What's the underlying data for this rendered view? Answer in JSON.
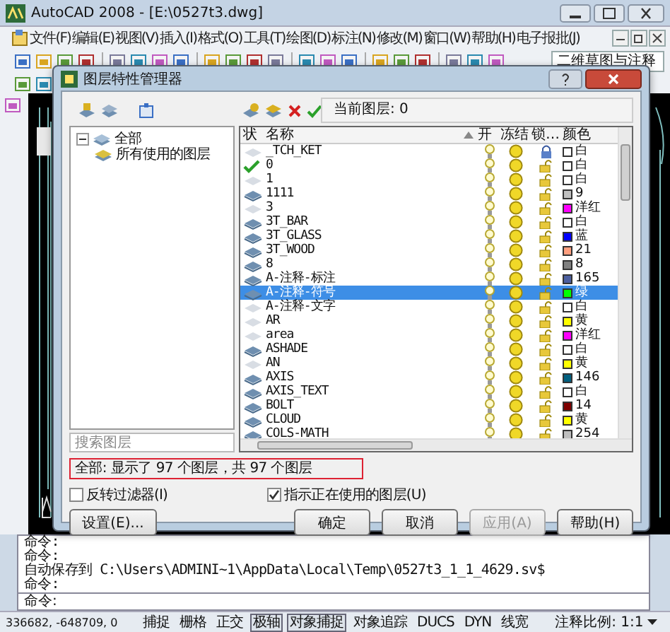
{
  "window": {
    "title": "AutoCAD 2008 - [E:\\0527t3.dwg]"
  },
  "menu": [
    "文件(F)",
    "编辑(E)",
    "视图(V)",
    "插入(I)",
    "格式(O)",
    "工具(T)",
    "绘图(D)",
    "标注(N)",
    "修改(M)",
    "窗口(W)",
    "帮助(H)",
    "电子报批(J)"
  ],
  "workspace": "二维草图与注释",
  "dialog": {
    "title": "图层特性管理器",
    "current_layer": "当前图层: 0",
    "filter_tree": [
      {
        "label": "全部",
        "expanded": true,
        "children": [
          {
            "label": "所有使用的图层"
          }
        ]
      }
    ],
    "search": {
      "placeholder": "搜索图层"
    },
    "columns": [
      "状",
      "名称",
      "开",
      "冻结",
      "锁…",
      "颜色"
    ],
    "layers": [
      {
        "kind": "unused",
        "name": "_TCH_KET",
        "on": true,
        "frozen": false,
        "locked": true,
        "color": "#ffffff",
        "color_name": "白",
        "selected": false
      },
      {
        "kind": "current",
        "name": "0",
        "on": true,
        "frozen": false,
        "locked": false,
        "color": "#ffffff",
        "color_name": "白",
        "selected": false
      },
      {
        "kind": "unused",
        "name": "1",
        "on": true,
        "frozen": false,
        "locked": false,
        "color": "#ffffff",
        "color_name": "白",
        "selected": false
      },
      {
        "kind": "used",
        "name": "1111",
        "on": true,
        "frozen": false,
        "locked": false,
        "color": "#c0c0c0",
        "color_name": "9",
        "selected": false
      },
      {
        "kind": "unused",
        "name": "3",
        "on": true,
        "frozen": false,
        "locked": false,
        "color": "#ff00ff",
        "color_name": "洋红",
        "selected": false
      },
      {
        "kind": "used",
        "name": "3T_BAR",
        "on": true,
        "frozen": false,
        "locked": false,
        "color": "#ffffff",
        "color_name": "白",
        "selected": false
      },
      {
        "kind": "used",
        "name": "3T_GLASS",
        "on": true,
        "frozen": false,
        "locked": false,
        "color": "#0000ff",
        "color_name": "蓝",
        "selected": false
      },
      {
        "kind": "used",
        "name": "3T_WOOD",
        "on": true,
        "frozen": false,
        "locked": false,
        "color": "#ff9f7f",
        "color_name": "21",
        "selected": false
      },
      {
        "kind": "used",
        "name": "8",
        "on": true,
        "frozen": false,
        "locked": false,
        "color": "#808080",
        "color_name": "8",
        "selected": false
      },
      {
        "kind": "used",
        "name": "A-注释-标注",
        "on": true,
        "frozen": false,
        "locked": false,
        "color": "#4c5fa0",
        "color_name": "165",
        "selected": false
      },
      {
        "kind": "used",
        "name": "A-注释-符号",
        "on": true,
        "frozen": false,
        "locked": false,
        "color": "#00ff00",
        "color_name": "绿",
        "selected": true
      },
      {
        "kind": "unused",
        "name": "A-注释-文字",
        "on": true,
        "frozen": false,
        "locked": false,
        "color": "#ffffff",
        "color_name": "白",
        "selected": false
      },
      {
        "kind": "unused",
        "name": "AR",
        "on": true,
        "frozen": false,
        "locked": false,
        "color": "#ffff00",
        "color_name": "黄",
        "selected": false
      },
      {
        "kind": "unused",
        "name": "area",
        "on": true,
        "frozen": false,
        "locked": false,
        "color": "#ff00ff",
        "color_name": "洋红",
        "selected": false
      },
      {
        "kind": "used",
        "name": "ASHADE",
        "on": true,
        "frozen": false,
        "locked": false,
        "color": "#ffffff",
        "color_name": "白",
        "selected": false
      },
      {
        "kind": "unused",
        "name": "AN",
        "on": true,
        "frozen": false,
        "locked": false,
        "color": "#ffff00",
        "color_name": "黄",
        "selected": false
      },
      {
        "kind": "used",
        "name": "AXIS",
        "on": true,
        "frozen": false,
        "locked": false,
        "color": "#005f7f",
        "color_name": "146",
        "selected": false
      },
      {
        "kind": "used",
        "name": "AXIS_TEXT",
        "on": true,
        "frozen": false,
        "locked": false,
        "color": "#ffffff",
        "color_name": "白",
        "selected": false
      },
      {
        "kind": "used",
        "name": "BOLT",
        "on": true,
        "frozen": false,
        "locked": false,
        "color": "#7f0000",
        "color_name": "14",
        "selected": false
      },
      {
        "kind": "used",
        "name": "CLOUD",
        "on": true,
        "frozen": false,
        "locked": false,
        "color": "#ffff00",
        "color_name": "黄",
        "selected": false
      },
      {
        "kind": "used",
        "name": "COLS-MATH",
        "on": true,
        "frozen": false,
        "locked": false,
        "color": "#bebebe",
        "color_name": "254",
        "selected": false
      }
    ],
    "summary": "全部: 显示了 97 个图层，共 97 个图层",
    "options": [
      {
        "label": "反转过滤器(I)",
        "checked": false
      },
      {
        "label": "指示正在使用的图层(U)",
        "checked": true
      }
    ],
    "buttons": [
      {
        "label": "设置(E)...",
        "disabled": false
      },
      {
        "label": "确定",
        "disabled": false
      },
      {
        "label": "取消",
        "disabled": false
      },
      {
        "label": "应用(A)",
        "disabled": true
      },
      {
        "label": "帮助(H)",
        "disabled": false
      }
    ]
  },
  "command_history": [
    "命令:",
    "命令:",
    "自动保存到 C:\\Users\\ADMINI~1\\AppData\\Local\\Temp\\0527t3_1_1_4629.sv$",
    "命令:"
  ],
  "command_prompt": "命令:",
  "status_bar": {
    "coordinates": "336682, -648709, 0",
    "toggles": [
      {
        "label": "捕捉",
        "on": false
      },
      {
        "label": "栅格",
        "on": false
      },
      {
        "label": "正交",
        "on": false
      },
      {
        "label": "极轴",
        "on": true
      },
      {
        "label": "对象捕捉",
        "on": true
      },
      {
        "label": "对象追踪",
        "on": false
      },
      {
        "label": "DUCS",
        "on": false
      },
      {
        "label": "DYN",
        "on": false
      },
      {
        "label": "线宽",
        "on": false
      }
    ],
    "annotation_scale": "注释比例: 1:1"
  }
}
